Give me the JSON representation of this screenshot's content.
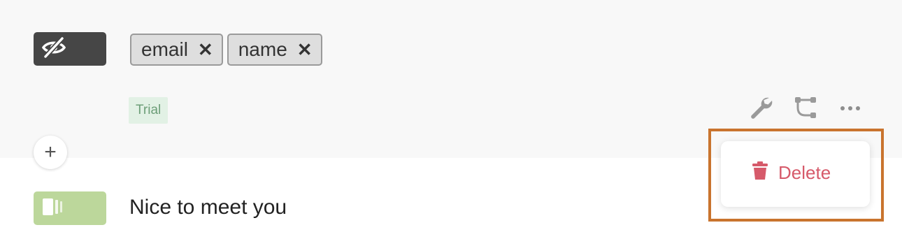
{
  "tags": [
    {
      "label": "email",
      "remove_glyph": "✕"
    },
    {
      "label": "name",
      "remove_glyph": "✕"
    }
  ],
  "badge": {
    "label": "Trial"
  },
  "toolbar": {
    "icons": [
      "wrench-icon",
      "flow-icon",
      "more-icon"
    ]
  },
  "add_block": {
    "glyph": "+"
  },
  "message_block": {
    "text": "Nice to meet you"
  },
  "context_menu": {
    "delete_label": "Delete",
    "delete_icon": "trash-icon"
  },
  "colors": {
    "hidden_block": "#464646",
    "text_block": "#bcd79b",
    "badge_bg": "#e2f1e5",
    "delete": "#d65a6a",
    "highlight": "#c9742e"
  }
}
